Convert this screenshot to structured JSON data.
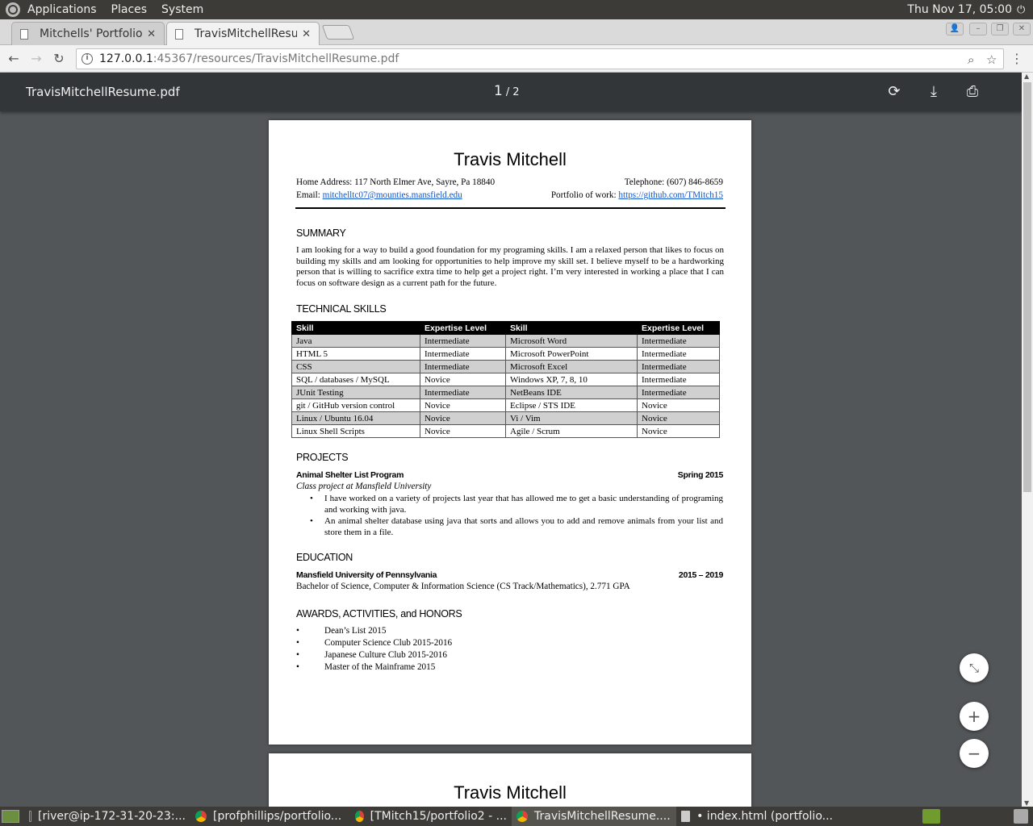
{
  "top_panel": {
    "menus": [
      "Applications",
      "Places",
      "System"
    ],
    "clock": "Thu Nov 17, 05:00"
  },
  "tabs": [
    {
      "label": "Mitchells' Portfolio",
      "active": false
    },
    {
      "label": "TravisMitchellResume.pdf",
      "active": true
    }
  ],
  "address_bar": {
    "host": "127.0.0.1",
    "rest": ":45367/resources/TravisMitchellResume.pdf"
  },
  "pdf_viewer": {
    "file_name": "TravisMitchellResume.pdf",
    "current_page": "1",
    "page_separator": "/",
    "total_pages": "2"
  },
  "resume": {
    "name": "Travis Mitchell",
    "address": "Home Address: 117 North Elmer Ave, Sayre, Pa 18840",
    "telephone": "Telephone: (607) 846-8659",
    "email_label": "Email: ",
    "email": "mitchelltc07@mounties.mansfield.edu",
    "portfolio_label": "Portfolio of work: ",
    "portfolio": "https://github.com/TMitch15",
    "summary_heading": "SUMMARY",
    "summary": "I am looking for a way to build a good foundation for my programing skills. I am a relaxed person that likes to focus on building my skills and am looking for opportunities to help improve my skill set. I believe myself to be a hardworking person that is willing to sacrifice extra time to help get a project right. I’m very interested in working a place that I can focus on software design as a current path for the future.",
    "skills_heading": "TECHNICAL SKILLS",
    "skills_headers": [
      "Skill",
      "Expertise Level",
      "Skill",
      "Expertise Level"
    ],
    "skills_rows": [
      [
        "Java",
        "Intermediate",
        "Microsoft Word",
        "Intermediate"
      ],
      [
        "HTML 5",
        "Intermediate",
        "Microsoft PowerPoint",
        "Intermediate"
      ],
      [
        "CSS",
        "Intermediate",
        "Microsoft Excel",
        "Intermediate"
      ],
      [
        "SQL / databases / MySQL",
        "Novice",
        "Windows XP, 7, 8, 10",
        "Intermediate"
      ],
      [
        "JUnit Testing",
        "Intermediate",
        "NetBeans IDE",
        "Intermediate"
      ],
      [
        "git / GitHub version control",
        "Novice",
        "Eclipse / STS IDE",
        "Novice"
      ],
      [
        "Linux / Ubuntu 16.04",
        "Novice",
        "Vi / Vim",
        "Novice"
      ],
      [
        "Linux Shell Scripts",
        "Novice",
        "Agile / Scrum",
        "Novice"
      ]
    ],
    "projects_heading": "PROJECTS",
    "project_title": "Animal Shelter List Program",
    "project_date": "Spring 2015",
    "project_subtitle": "Class project at Mansfield University",
    "project_bullets": [
      "I have worked on a variety of projects last year that has allowed me to get a basic understanding of programing and working with java.",
      "An animal shelter database using java that sorts and allows you to add and remove animals from your list and store them in a file."
    ],
    "education_heading": "EDUCATION",
    "school": "Mansfield University of Pennsylvania",
    "school_dates": "2015 – 2019",
    "degree": "Bachelor of Science, Computer & Information Science (CS Track/Mathematics), 2.771 GPA",
    "awards_heading": "AWARDS, ACTIVITIES, and HONORS",
    "awards": [
      "Dean’s List 2015",
      "Computer Science Club 2015-2016",
      "Japanese Culture Club 2015-2016",
      "Master of the Mainframe 2015"
    ],
    "page2_name": "Travis Mitchell"
  },
  "taskbar": {
    "items": [
      {
        "label": "[river@ip-172-31-20-23:...",
        "icon": "terminal-icon"
      },
      {
        "label": "[profphillips/portfolio...",
        "icon": "chrome-icon"
      },
      {
        "label": "[TMitch15/portfolio2 - ...",
        "icon": "chrome-icon"
      },
      {
        "label": "TravisMitchellResume....",
        "icon": "chrome-icon"
      },
      {
        "label": "• index.html (portfolio...",
        "icon": "editor-icon"
      }
    ]
  }
}
